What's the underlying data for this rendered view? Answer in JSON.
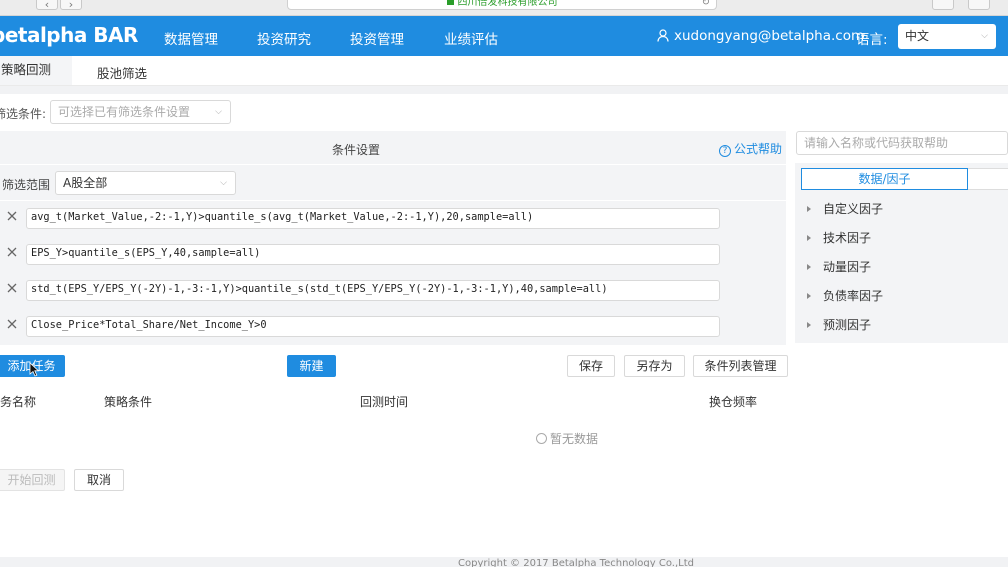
{
  "browser": {
    "address_text": "四川倍发科技有限公司",
    "back_glyph": "‹",
    "forward_glyph": "›",
    "reload_glyph": "↻"
  },
  "nav": {
    "logo": "betalpha BAR",
    "items": [
      "数据管理",
      "投资研究",
      "投资管理",
      "业绩评估"
    ],
    "user_email": "xudongyang@betalpha.com",
    "language_label": "语言:",
    "language_value": "中文"
  },
  "tabs": [
    "策略回测",
    "股池筛选"
  ],
  "filter": {
    "label": "筛选条件:",
    "placeholder": "可选择已有筛选条件设置"
  },
  "conditions_panel": {
    "title": "条件设置",
    "help_label": "公式帮助",
    "range_label": "筛选范围",
    "range_value": "A股全部",
    "items": [
      "avg_t(Market_Value,-2:-1,Y)>quantile_s(avg_t(Market_Value,-2:-1,Y),20,sample=all)",
      "EPS_Y>quantile_s(EPS_Y,40,sample=all)",
      "std_t(EPS_Y/EPS_Y(-2Y)-1,-3:-1,Y)>quantile_s(std_t(EPS_Y/EPS_Y(-2Y)-1,-3:-1,Y),40,sample=all)",
      "Close_Price*Total_Share/Net_Income_Y>0"
    ]
  },
  "side_panel": {
    "search_placeholder": "请输入名称或代码获取帮助",
    "tab_label": "数据/因子",
    "tree": [
      "自定义因子",
      "技术因子",
      "动量因子",
      "负债率因子",
      "预测因子"
    ]
  },
  "actions": {
    "add_task": "添加任务",
    "new": "新建",
    "save": "保存",
    "save_as": "另存为",
    "manage": "条件列表管理"
  },
  "table": {
    "headers": [
      "务名称",
      "策略条件",
      "回测时间",
      "换仓频率"
    ],
    "empty_text": "暂无数据"
  },
  "bottom_actions": {
    "start": "开始回测",
    "cancel": "取消"
  },
  "footer": {
    "copyright": "Copyright © 2017 Betalpha Technology Co.,Ltd"
  },
  "colors": {
    "brand": "#1f8ce0",
    "panel_bg": "#f3f4f6"
  }
}
